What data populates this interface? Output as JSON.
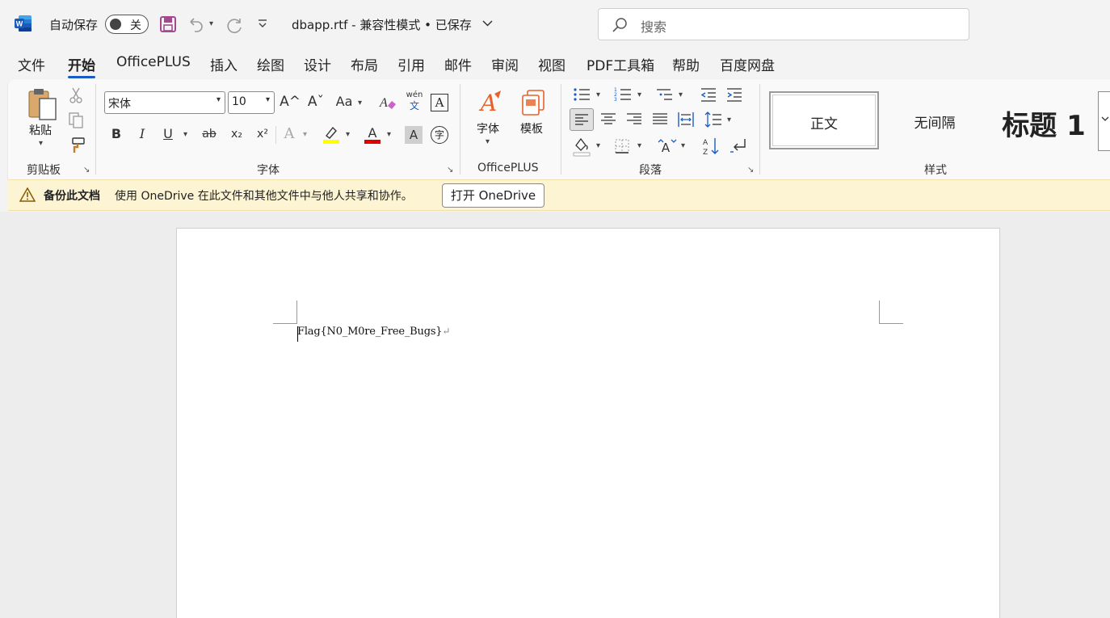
{
  "titlebar": {
    "autosave_label": "自动保存",
    "autosave_state": "关",
    "doc_title": "dbapp.rtf  -  兼容性模式 • 已保存",
    "search_placeholder": "搜索"
  },
  "tabs": [
    {
      "label": "文件"
    },
    {
      "label": "开始"
    },
    {
      "label": "OfficePLUS"
    },
    {
      "label": "插入"
    },
    {
      "label": "绘图"
    },
    {
      "label": "设计"
    },
    {
      "label": "布局"
    },
    {
      "label": "引用"
    },
    {
      "label": "邮件"
    },
    {
      "label": "审阅"
    },
    {
      "label": "视图"
    },
    {
      "label": "PDF工具箱"
    },
    {
      "label": "帮助"
    },
    {
      "label": "百度网盘"
    }
  ],
  "active_tab": "开始",
  "ribbon": {
    "clipboard": {
      "paste_label": "粘贴",
      "group_label": "剪贴板"
    },
    "font": {
      "font_name": "宋体",
      "font_size": "10",
      "group_label": "字体",
      "bold": "B",
      "italic": "I",
      "underline": "U",
      "strike": "ab",
      "sub": "x₂",
      "sup": "x²",
      "grow": "A^",
      "shrink": "Aˇ",
      "case": "Aa",
      "phonetic_top": "wén",
      "phonetic_bottom": "文",
      "border_char": "A",
      "effects": "A",
      "shading": "A",
      "enclose": "字"
    },
    "officeplus": {
      "font_btn": "字体",
      "template_btn": "模板",
      "group_label": "OfficePLUS"
    },
    "paragraph": {
      "group_label": "段落"
    },
    "styles": {
      "group_label": "样式",
      "items": [
        "正文",
        "无间隔",
        "标题 1"
      ]
    }
  },
  "message_bar": {
    "title": "备份此文档",
    "text": "使用 OneDrive 在此文件和其他文件中与他人共享和协作。",
    "button": "打开 OneDrive"
  },
  "document": {
    "text": "Flag{N0_M0re_Free_Bugs}",
    "paragraph_mark": "↵"
  },
  "colors": {
    "accent_blue": "#1a5cc5",
    "highlight_yellow": "#ffff00",
    "font_red": "#e00000",
    "message_bar_bg": "#fdf4d3"
  }
}
